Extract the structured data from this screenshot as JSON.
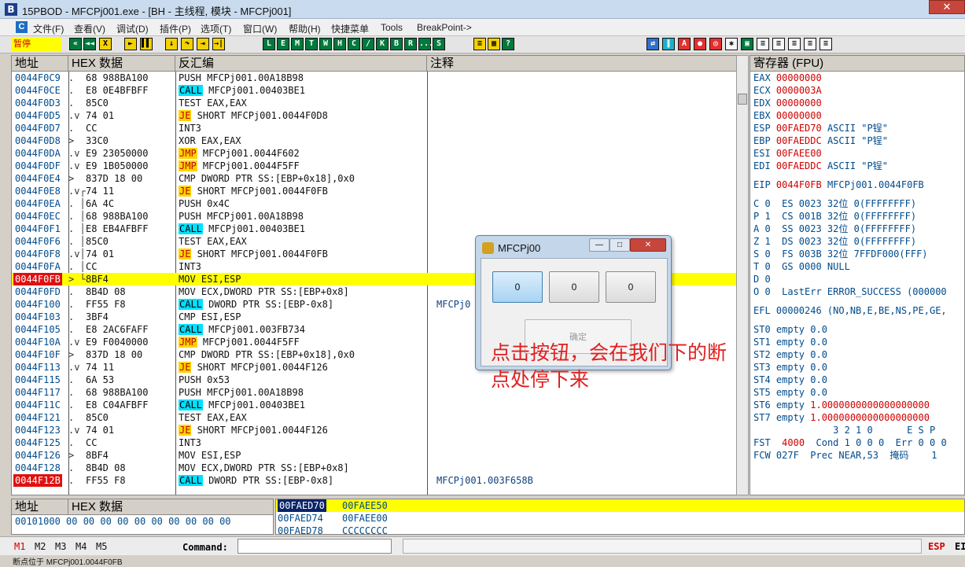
{
  "window": {
    "title": "15PBOD - MFCPj001.exe - [BH - 主线程, 模块 - MFCPj001]",
    "icon": "B",
    "close": "✕"
  },
  "menu": [
    "文件(F)",
    "查看(V)",
    "调试(D)",
    "插件(P)",
    "选项(T)",
    "窗口(W)",
    "帮助(H)",
    "快捷菜单",
    "Tools",
    "BreakPoint->"
  ],
  "toolbar": {
    "status": "暂停",
    "buttons": [
      "«",
      "◄◄",
      "X",
      "►",
      "▌▌",
      "↓",
      "↷",
      "⇥",
      "→|",
      "L",
      "E",
      "M",
      "T",
      "W",
      "H",
      "C",
      "/",
      "K",
      "B",
      "R",
      "...",
      "S"
    ]
  },
  "cpu": {
    "headers": {
      "addr": "地址",
      "hex": "HEX 数据",
      "asm": "反汇编",
      "comment": "注释"
    },
    "rows": [
      {
        "addr": "0044F0C9",
        "j": ".",
        "hex": "68 988BA100",
        "asm": "PUSH MFCPj001.00A18B98",
        "kw": "",
        "c": ""
      },
      {
        "addr": "0044F0CE",
        "j": ".",
        "hex": "E8 0E4BFBFF",
        "asm": " MFCPj001.00403BE1",
        "kw": "CALL",
        "c": ""
      },
      {
        "addr": "0044F0D3",
        "j": ".",
        "hex": "85C0",
        "asm": "TEST EAX,EAX",
        "kw": "",
        "c": ""
      },
      {
        "addr": "0044F0D5",
        "j": ".v",
        "hex": "74 01",
        "asm": " SHORT MFCPj001.0044F0D8",
        "kw": "JE",
        "c": ""
      },
      {
        "addr": "0044F0D7",
        "j": ".",
        "hex": "CC",
        "asm": "INT3",
        "kw": "",
        "c": ""
      },
      {
        "addr": "0044F0D8",
        "j": ">",
        "hex": "33C0",
        "asm": "XOR EAX,EAX",
        "kw": "",
        "c": ""
      },
      {
        "addr": "0044F0DA",
        "j": ".v",
        "hex": "E9 23050000",
        "asm": " MFCPj001.0044F602",
        "kw": "JMP",
        "c": ""
      },
      {
        "addr": "0044F0DF",
        "j": ".v",
        "hex": "E9 1B050000",
        "asm": " MFCPj001.0044F5FF",
        "kw": "JMP",
        "c": ""
      },
      {
        "addr": "0044F0E4",
        "j": ">",
        "hex": "837D 18 00",
        "asm": "CMP DWORD PTR SS:[EBP+0x18],0x0",
        "kw": "",
        "c": ""
      },
      {
        "addr": "0044F0E8",
        "j": ".v┌",
        "hex": "74 11",
        "asm": " SHORT MFCPj001.0044F0FB",
        "kw": "JE",
        "c": ""
      },
      {
        "addr": "0044F0EA",
        "j": ". │",
        "hex": "6A 4C",
        "asm": "PUSH 0x4C",
        "kw": "",
        "c": ""
      },
      {
        "addr": "0044F0EC",
        "j": ". │",
        "hex": "68 988BA100",
        "asm": "PUSH MFCPj001.00A18B98",
        "kw": "",
        "c": ""
      },
      {
        "addr": "0044F0F1",
        "j": ". │",
        "hex": "E8 EB4AFBFF",
        "asm": " MFCPj001.00403BE1",
        "kw": "CALL",
        "c": ""
      },
      {
        "addr": "0044F0F6",
        "j": ". │",
        "hex": "85C0",
        "asm": "TEST EAX,EAX",
        "kw": "",
        "c": ""
      },
      {
        "addr": "0044F0F8",
        "j": ".v│",
        "hex": "74 01",
        "asm": " SHORT MFCPj001.0044F0FB",
        "kw": "JE",
        "c": ""
      },
      {
        "addr": "0044F0FA",
        "j": ". │",
        "hex": "CC",
        "asm": "INT3",
        "kw": "",
        "c": ""
      },
      {
        "addr": "0044F0FB",
        "j": "> └",
        "hex": "8BF4",
        "asm": "MOV ESI,ESP",
        "kw": "",
        "c": "",
        "sel": true
      },
      {
        "addr": "0044F0FD",
        "j": ".",
        "hex": "8B4D 08",
        "asm": "MOV ECX,DWORD PTR SS:[EBP+0x8]",
        "kw": "",
        "c": ""
      },
      {
        "addr": "0044F100",
        "j": ".",
        "hex": "FF55 F8",
        "asm": " DWORD PTR SS:[EBP-0x8]",
        "kw": "CALL",
        "c": "MFCPj0"
      },
      {
        "addr": "0044F103",
        "j": ".",
        "hex": "3BF4",
        "asm": "CMP ESI,ESP",
        "kw": "",
        "c": ""
      },
      {
        "addr": "0044F105",
        "j": ".",
        "hex": "E8 2AC6FAFF",
        "asm": " MFCPj001.003FB734",
        "kw": "CALL",
        "c": ""
      },
      {
        "addr": "0044F10A",
        "j": ".v",
        "hex": "E9 F0040000",
        "asm": " MFCPj001.0044F5FF",
        "kw": "JMP",
        "c": ""
      },
      {
        "addr": "0044F10F",
        "j": ">",
        "hex": "837D 18 00",
        "asm": "CMP DWORD PTR SS:[EBP+0x18],0x0",
        "kw": "",
        "c": ""
      },
      {
        "addr": "0044F113",
        "j": ".v",
        "hex": "74 11",
        "asm": " SHORT MFCPj001.0044F126",
        "kw": "JE",
        "c": ""
      },
      {
        "addr": "0044F115",
        "j": ".",
        "hex": "6A 53",
        "asm": "PUSH 0x53",
        "kw": "",
        "c": ""
      },
      {
        "addr": "0044F117",
        "j": ".",
        "hex": "68 988BA100",
        "asm": "PUSH MFCPj001.00A18B98",
        "kw": "",
        "c": ""
      },
      {
        "addr": "0044F11C",
        "j": ".",
        "hex": "E8 C04AFBFF",
        "asm": " MFCPj001.00403BE1",
        "kw": "CALL",
        "c": ""
      },
      {
        "addr": "0044F121",
        "j": ".",
        "hex": "85C0",
        "asm": "TEST EAX,EAX",
        "kw": "",
        "c": ""
      },
      {
        "addr": "0044F123",
        "j": ".v",
        "hex": "74 01",
        "asm": " SHORT MFCPj001.0044F126",
        "kw": "JE",
        "c": ""
      },
      {
        "addr": "0044F125",
        "j": ".",
        "hex": "CC",
        "asm": "INT3",
        "kw": "",
        "c": ""
      },
      {
        "addr": "0044F126",
        "j": ">",
        "hex": "8BF4",
        "asm": "MOV ESI,ESP",
        "kw": "",
        "c": ""
      },
      {
        "addr": "0044F128",
        "j": ".",
        "hex": "8B4D 08",
        "asm": "MOV ECX,DWORD PTR SS:[EBP+0x8]",
        "kw": "",
        "c": ""
      },
      {
        "addr": "0044F12B",
        "j": ".",
        "hex": "FF55 F8",
        "asm": " DWORD PTR SS:[EBP-0x8]",
        "kw": "CALL",
        "c": "MFCPj001.003F658B",
        "bp": true
      }
    ]
  },
  "registers": {
    "header": "寄存器 (FPU)",
    "lines": [
      {
        "n": "EAX",
        "v": "00000000",
        "t": ""
      },
      {
        "n": "ECX",
        "v": "0000003A",
        "t": ""
      },
      {
        "n": "EDX",
        "v": "00000000",
        "t": ""
      },
      {
        "n": "EBX",
        "v": "00000000",
        "t": ""
      },
      {
        "n": "ESP",
        "v": "00FAED70",
        "t": " ASCII \"P锃\""
      },
      {
        "n": "EBP",
        "v": "00FAEDDC",
        "t": " ASCII \"P锃\""
      },
      {
        "n": "ESI",
        "v": "00FAEE00",
        "t": ""
      },
      {
        "n": "EDI",
        "v": "00FAEDDC",
        "t": " ASCII \"P锃\""
      },
      {
        "n": "",
        "v": "",
        "t": ""
      },
      {
        "n": "EIP",
        "v": "0044F0FB",
        "t": " MFCPj001.0044F0FB"
      },
      {
        "n": "",
        "v": "",
        "t": ""
      },
      {
        "n": "C 0  ES 0023 32位 0(FFFFFFFF)",
        "v": "",
        "t": ""
      },
      {
        "n": "P 1  CS 001B 32位 0(FFFFFFFF)",
        "v": "",
        "t": ""
      },
      {
        "n": "A 0  SS 0023 32位 0(FFFFFFFF)",
        "v": "",
        "t": ""
      },
      {
        "n": "Z 1  DS 0023 32位 0(FFFFFFFF)",
        "v": "",
        "t": ""
      },
      {
        "n": "S 0  FS 003B 32位 7FFDF000(FFF)",
        "v": "",
        "t": ""
      },
      {
        "n": "T 0  GS 0000 NULL",
        "v": "",
        "t": ""
      },
      {
        "n": "D 0",
        "v": "",
        "t": ""
      },
      {
        "n": "O 0  LastErr ERROR_SUCCESS (000000",
        "v": "",
        "t": ""
      },
      {
        "n": "",
        "v": "",
        "t": ""
      },
      {
        "n": "EFL 00000246 (NO,NB,E,BE,NS,PE,GE,",
        "v": "",
        "t": ""
      },
      {
        "n": "",
        "v": "",
        "t": ""
      },
      {
        "n": "ST0 empty 0.0",
        "v": "",
        "t": ""
      },
      {
        "n": "ST1 empty 0.0",
        "v": "",
        "t": ""
      },
      {
        "n": "ST2 empty 0.0",
        "v": "",
        "t": ""
      },
      {
        "n": "ST3 empty 0.0",
        "v": "",
        "t": ""
      },
      {
        "n": "ST4 empty 0.0",
        "v": "",
        "t": ""
      },
      {
        "n": "ST5 empty 0.0",
        "v": "",
        "t": ""
      },
      {
        "n": "ST6 empty ",
        "v": "",
        "t": "1.0000000000000000000"
      },
      {
        "n": "ST7 empty ",
        "v": "",
        "t": "1.0000000000000000000"
      },
      {
        "n": "              3 2 1 0      E S P",
        "v": "",
        "t": ""
      },
      {
        "n": "FST ",
        "v": "4000",
        "t": "  Cond 1 0 0 0  Err 0 0 0"
      },
      {
        "n": "FCW 027F  Prec NEAR,53  掩码    1",
        "v": "",
        "t": ""
      }
    ]
  },
  "dump": {
    "headers": {
      "addr": "地址",
      "hex": "HEX 数据"
    },
    "rows": [
      "00101000 00 00 00 00 00 00 00 00 00 00"
    ]
  },
  "stack": [
    {
      "a": "00FAED70",
      "v": "00FAEE50",
      "sel": true
    },
    {
      "a": "00FAED74",
      "v": "00FAEE00",
      "sel": false
    },
    {
      "a": "00FAED78",
      "v": "CCCCCCCC",
      "sel": false
    }
  ],
  "cmdbar": {
    "m": [
      "M1",
      "M2",
      "M3",
      "M4",
      "M5"
    ],
    "label": "Command:",
    "esp": "ESP",
    "esp2": "EI"
  },
  "statusbar": "断点位于 MFCPj001.0044F0FB",
  "dialog": {
    "title": "MFCPj00",
    "buttons": [
      "0",
      "0",
      "0"
    ],
    "ok": "确定",
    "min": "—",
    "max": "□",
    "close": "✕"
  },
  "note": "点击按钮，会在我们下的断点处停下来"
}
